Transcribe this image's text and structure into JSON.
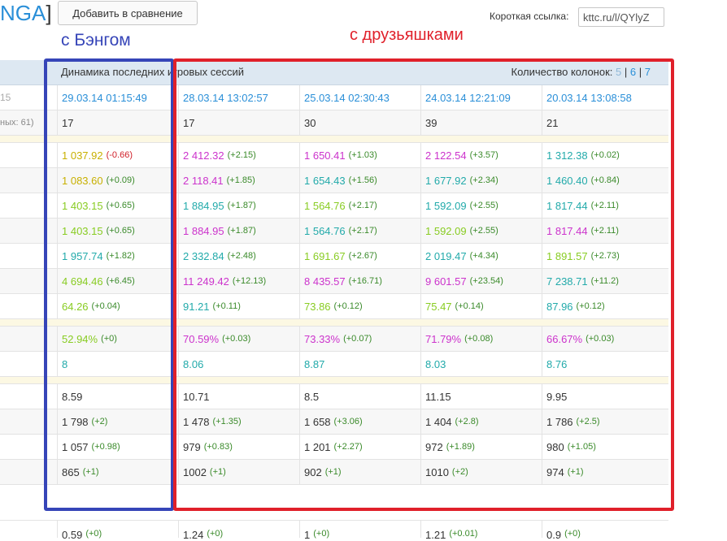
{
  "header": {
    "brand_partial": "NGA",
    "brand_bracket": "]",
    "compare_button": "Добавить в сравнение",
    "short_link_label": "Короткая ссылка:",
    "short_link_value": "kttc.ru/l/QYlyZ"
  },
  "annotations": {
    "left_label": "с Бэнгом",
    "right_label": "с друзьяшками",
    "left_box_color": "#3645b8",
    "right_box_color": "#e0202a"
  },
  "table": {
    "title": "Динамика последних игровых сессий",
    "columns_label": "Количество колонок:",
    "columns_options": [
      "5",
      "6",
      "7"
    ],
    "columns_separator": "|",
    "dates": [
      "15",
      "29.03.14 01:15:49",
      "28.03.14 13:02:57",
      "25.03.14 02:30:43",
      "24.03.14 12:21:09",
      "20.03.14 13:08:58"
    ],
    "battles_label": "ных: 61)",
    "battles": [
      "17",
      "17",
      "30",
      "39",
      "21"
    ],
    "section1": [
      [
        [
          "1 037.92",
          "-0.66",
          "yellow",
          "neg"
        ],
        [
          "2 412.32",
          "+2.15",
          "magenta",
          "pos"
        ],
        [
          "1 650.41",
          "+1.03",
          "magenta",
          "pos"
        ],
        [
          "2 122.54",
          "+3.57",
          "magenta",
          "pos"
        ],
        [
          "1 312.38",
          "+0.02",
          "teal",
          "pos"
        ]
      ],
      [
        [
          "1 083.60",
          "+0.09",
          "yellow",
          "pos"
        ],
        [
          "2 118.41",
          "+1.85",
          "magenta",
          "pos"
        ],
        [
          "1 654.43",
          "+1.56",
          "teal",
          "pos"
        ],
        [
          "1 677.92",
          "+2.34",
          "teal",
          "pos"
        ],
        [
          "1 460.40",
          "+0.84",
          "teal",
          "pos"
        ]
      ],
      [
        [
          "1 403.15",
          "+0.65",
          "green",
          "pos"
        ],
        [
          "1 884.95",
          "+1.87",
          "teal",
          "pos"
        ],
        [
          "1 564.76",
          "+2.17",
          "green",
          "pos"
        ],
        [
          "1 592.09",
          "+2.55",
          "teal",
          "pos"
        ],
        [
          "1 817.44",
          "+2.11",
          "teal",
          "pos"
        ]
      ],
      [
        [
          "1 403.15",
          "+0.65",
          "green",
          "pos"
        ],
        [
          "1 884.95",
          "+1.87",
          "magenta",
          "pos"
        ],
        [
          "1 564.76",
          "+2.17",
          "teal",
          "pos"
        ],
        [
          "1 592.09",
          "+2.55",
          "green",
          "pos"
        ],
        [
          "1 817.44",
          "+2.11",
          "magenta",
          "pos"
        ]
      ],
      [
        [
          "1 957.74",
          "+1.82",
          "teal",
          "pos"
        ],
        [
          "2 332.84",
          "+2.48",
          "teal",
          "pos"
        ],
        [
          "1 691.67",
          "+2.67",
          "green",
          "pos"
        ],
        [
          "2 019.47",
          "+4.34",
          "teal",
          "pos"
        ],
        [
          "1 891.57",
          "+2.73",
          "green",
          "pos"
        ]
      ],
      [
        [
          "4 694.46",
          "+6.45",
          "green",
          "pos"
        ],
        [
          "11 249.42",
          "+12.13",
          "magenta",
          "pos"
        ],
        [
          "8 435.57",
          "+16.71",
          "magenta",
          "pos"
        ],
        [
          "9 601.57",
          "+23.54",
          "magenta",
          "pos"
        ],
        [
          "7 238.71",
          "+11.2",
          "teal",
          "pos"
        ]
      ],
      [
        [
          "64.26",
          "+0.04",
          "green",
          "pos"
        ],
        [
          "91.21",
          "+0.11",
          "teal",
          "pos"
        ],
        [
          "73.86",
          "+0.12",
          "green",
          "pos"
        ],
        [
          "75.47",
          "+0.14",
          "green",
          "pos"
        ],
        [
          "87.96",
          "+0.12",
          "teal",
          "pos"
        ]
      ]
    ],
    "section2": [
      [
        [
          "52.94%",
          "+0",
          "green",
          "pos"
        ],
        [
          "70.59%",
          "+0.03",
          "magenta",
          "pos"
        ],
        [
          "73.33%",
          "+0.07",
          "magenta",
          "pos"
        ],
        [
          "71.79%",
          "+0.08",
          "magenta",
          "pos"
        ],
        [
          "66.67%",
          "+0.03",
          "magenta",
          "pos"
        ]
      ],
      [
        [
          "8",
          "",
          "teal",
          "pos"
        ],
        [
          "8.06",
          "",
          "teal",
          "pos"
        ],
        [
          "8.87",
          "",
          "teal",
          "pos"
        ],
        [
          "8.03",
          "",
          "teal",
          "pos"
        ],
        [
          "8.76",
          "",
          "teal",
          "pos"
        ]
      ]
    ],
    "section3": [
      [
        [
          "8.59",
          "",
          "dark",
          "pos"
        ],
        [
          "10.71",
          "",
          "dark",
          "pos"
        ],
        [
          "8.5",
          "",
          "dark",
          "pos"
        ],
        [
          "11.15",
          "",
          "dark",
          "pos"
        ],
        [
          "9.95",
          "",
          "dark",
          "pos"
        ]
      ],
      [
        [
          "1 798",
          "+2",
          "dark",
          "pos"
        ],
        [
          "1 478",
          "+1.35",
          "dark",
          "pos"
        ],
        [
          "1 658",
          "+3.06",
          "dark",
          "pos"
        ],
        [
          "1 404",
          "+2.8",
          "dark",
          "pos"
        ],
        [
          "1 786",
          "+2.5",
          "dark",
          "pos"
        ]
      ],
      [
        [
          "1 057",
          "+0.98",
          "dark",
          "pos"
        ],
        [
          "979",
          "+0.83",
          "dark",
          "pos"
        ],
        [
          "1 201",
          "+2.27",
          "dark",
          "pos"
        ],
        [
          "972",
          "+1.89",
          "dark",
          "pos"
        ],
        [
          "980",
          "+1.05",
          "dark",
          "pos"
        ]
      ],
      [
        [
          "865",
          "+1",
          "dark",
          "pos"
        ],
        [
          "1002",
          "+1",
          "dark",
          "pos"
        ],
        [
          "902",
          "+1",
          "dark",
          "pos"
        ],
        [
          "1010",
          "+2",
          "dark",
          "pos"
        ],
        [
          "974",
          "+1",
          "dark",
          "pos"
        ]
      ]
    ],
    "bottom_row": [
      [
        "0.59",
        "+0"
      ],
      [
        "1.24",
        "+0"
      ],
      [
        "1",
        "+0"
      ],
      [
        "1.21",
        "+0.01"
      ],
      [
        "0.9",
        "+0"
      ]
    ]
  }
}
